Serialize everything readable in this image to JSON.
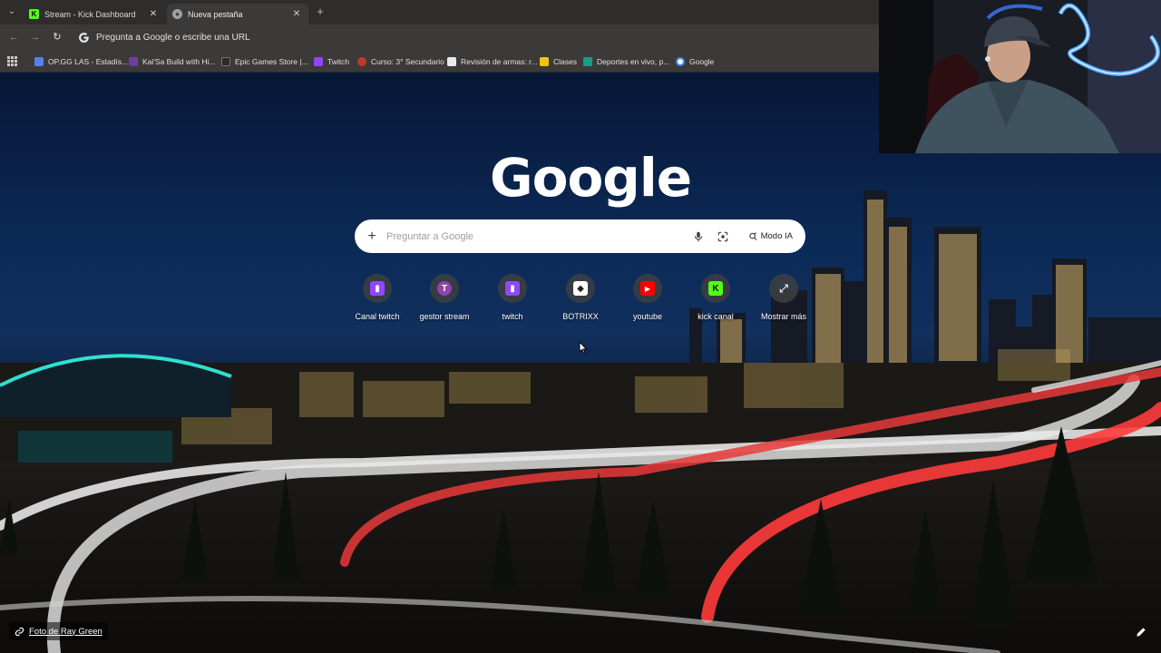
{
  "tabs": [
    {
      "label": "Stream - Kick Dashboard",
      "close": "✕"
    },
    {
      "label": "Nueva pestaña",
      "close": "✕"
    }
  ],
  "tabstrip": {
    "menu_glyph": "⌄",
    "new_tab_glyph": "+"
  },
  "toolbar": {
    "back_glyph": "←",
    "forward_glyph": "→",
    "reload_glyph": "↻",
    "omnibox_text": "Pregunta a Google o escribe una URL"
  },
  "bookmarks": [
    {
      "label": "OP.GG LAS - Estadís...",
      "color": "#5383e8"
    },
    {
      "label": "Kai'Sa Build with Hi...",
      "color": "#6b3fa0"
    },
    {
      "label": "Epic Games Store |...",
      "color": "#2a2a2a"
    },
    {
      "label": "Twitch",
      "color": "#9146ff"
    },
    {
      "label": "Curso: 3° Secundario",
      "color": "#c0392b"
    },
    {
      "label": "Revisión de armas: r...",
      "color": "#e8eaed"
    },
    {
      "label": "Clases",
      "color": "#f1c40f"
    },
    {
      "label": "Deportes en vivo, p...",
      "color": "#16a085"
    },
    {
      "label": "Google",
      "color": "#4285f4"
    }
  ],
  "ntp": {
    "logo": "Google",
    "search_placeholder": "Preguntar a Google",
    "plus_glyph": "+",
    "ai_mode_label": "Modo IA",
    "shortcuts": [
      {
        "label": "Canal twitch",
        "glyph": "▮",
        "tile_color": "#9146ff",
        "glyph_color": "#ffffff"
      },
      {
        "label": "gestor stream",
        "glyph": "T",
        "tile_color": "#8e44ad",
        "glyph_color": "#ffffff"
      },
      {
        "label": "twitch",
        "glyph": "▮",
        "tile_color": "#9146ff",
        "glyph_color": "#ffffff"
      },
      {
        "label": "BOTRIXX",
        "glyph": "◆",
        "tile_color": "#ffffff",
        "glyph_color": "#202124"
      },
      {
        "label": "youtube",
        "glyph": "▶",
        "tile_color": "#ff0000",
        "glyph_color": "#ffffff"
      },
      {
        "label": "kick canal",
        "glyph": "K",
        "tile_color": "#53fc18",
        "glyph_color": "#0b0b0b"
      },
      {
        "label": "Mostrar más",
        "glyph": "⤢",
        "tile_color": "transparent",
        "glyph_color": "#e8eaed"
      }
    ],
    "photo_credit": "Foto de Ray Green"
  }
}
